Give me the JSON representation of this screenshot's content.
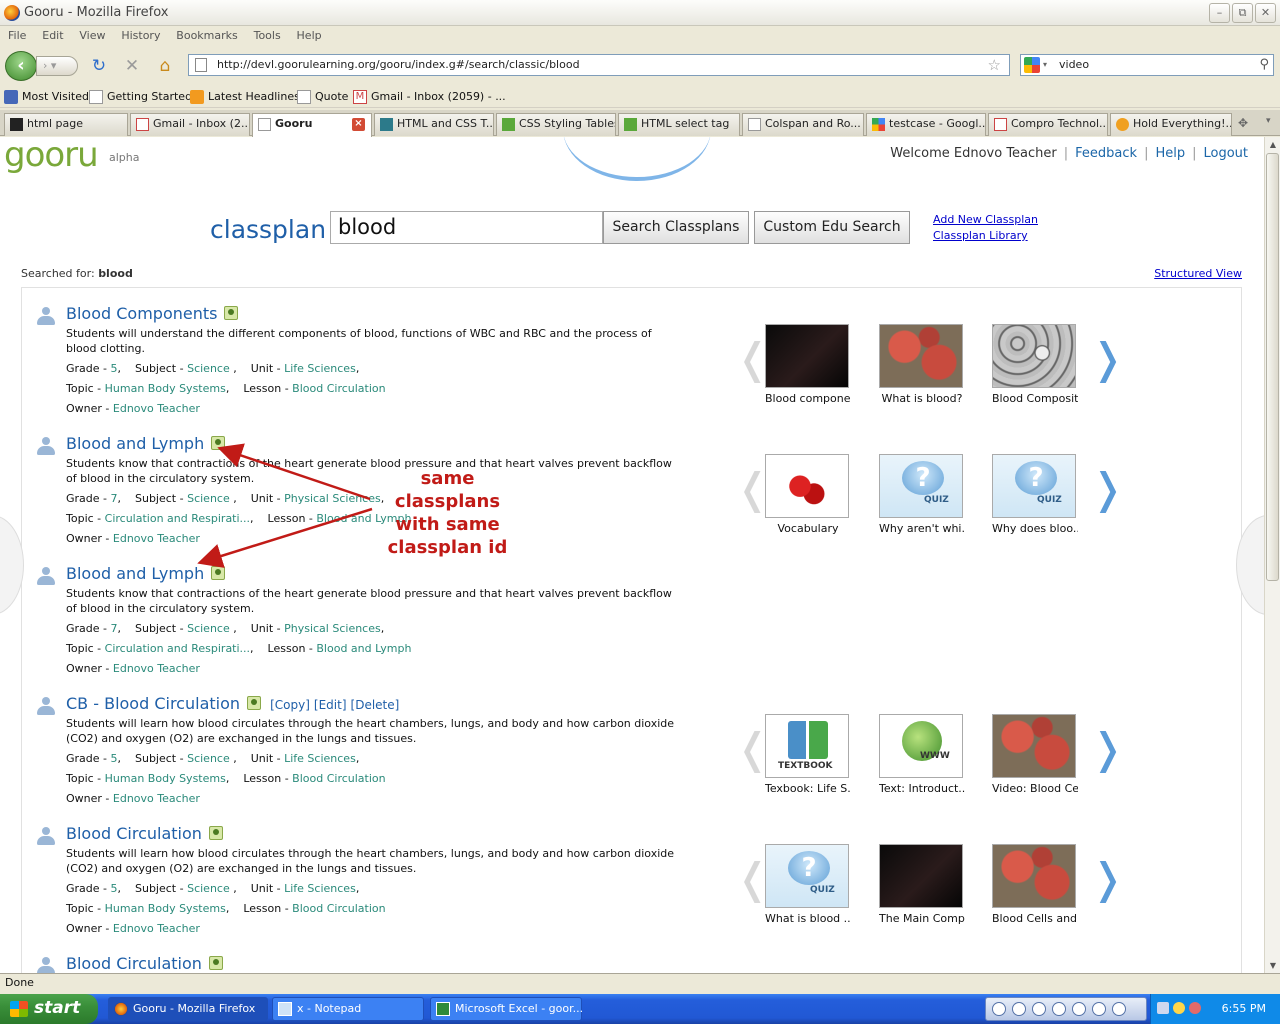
{
  "window": {
    "title": "Gooru - Mozilla Firefox"
  },
  "menu": [
    "File",
    "Edit",
    "View",
    "History",
    "Bookmarks",
    "Tools",
    "Help"
  ],
  "url": "http://devl.goorulearning.org/gooru/index.g#/search/classic/blood",
  "search_engine_value": "video",
  "bookmarks": [
    "Most Visited",
    "Getting Started",
    "Latest Headlines",
    "Quote",
    "Gmail - Inbox (2059) - ..."
  ],
  "tabs": [
    {
      "label": "html page",
      "active": false
    },
    {
      "label": "Gmail - Inbox (2...",
      "active": false
    },
    {
      "label": "Gooru",
      "active": true
    },
    {
      "label": "HTML and CSS T...",
      "active": false
    },
    {
      "label": "CSS Styling Tables",
      "active": false
    },
    {
      "label": "HTML select tag",
      "active": false
    },
    {
      "label": "Colspan and Ro...",
      "active": false
    },
    {
      "label": "testcase - Googl...",
      "active": false
    },
    {
      "label": "Compro Technol...",
      "active": false
    },
    {
      "label": "Hold Everything!...",
      "active": false
    }
  ],
  "site": {
    "logo": "gooru",
    "logo_sub": "alpha",
    "welcome": "Welcome Ednovo Teacher",
    "links": {
      "feedback": "Feedback",
      "help": "Help",
      "logout": "Logout"
    }
  },
  "search": {
    "label": "classplan",
    "value": "blood",
    "btn_search": "Search Classplans",
    "btn_custom": "Custom Edu Search",
    "add_new": "Add New Classplan",
    "library": "Classplan Library",
    "searched_for_label": "Searched for:",
    "searched_for_value": "blood",
    "structured_view": "Structured View"
  },
  "field_labels": {
    "grade": "Grade - ",
    "subject": "Subject - ",
    "unit": "Unit - ",
    "topic": "Topic - ",
    "lesson": "Lesson - ",
    "owner": "Owner - "
  },
  "results": [
    {
      "title": "Blood Components",
      "desc": "Students will understand the different components of blood, functions of WBC and RBC and the process of blood clotting.",
      "grade": "5",
      "subject": "Science",
      "unit": "Life Sciences",
      "topic": "Human Body Systems",
      "lesson": "Blood Circulation",
      "owner": "Ednovo Teacher",
      "thumbs": [
        {
          "caption": "Blood compone...",
          "kind": "dark"
        },
        {
          "caption": "What is blood?",
          "kind": "red"
        },
        {
          "caption": "Blood Compositi...",
          "kind": "grey"
        }
      ]
    },
    {
      "title": "Blood and Lymph",
      "desc": "Students know that contractions of the heart generate blood pressure and that heart valves prevent backflow of blood in the circulatory system.",
      "grade": "7",
      "subject": "Science",
      "unit": "Physical Sciences",
      "topic": "Circulation and Respirati...",
      "lesson": "Blood and Lymph",
      "owner": "Ednovo Teacher",
      "thumbs": [
        {
          "caption": "Vocabulary",
          "kind": "vocab"
        },
        {
          "caption": "Why aren't whi...",
          "kind": "quiz"
        },
        {
          "caption": "Why does bloo...",
          "kind": "quiz"
        }
      ]
    },
    {
      "title": "Blood and Lymph",
      "desc": "Students know that contractions of the heart generate blood pressure and that heart valves prevent backflow of blood in the circulatory system.",
      "grade": "7",
      "subject": "Science",
      "unit": "Physical Sciences",
      "topic": "Circulation and Respirati...",
      "lesson": "Blood and Lymph",
      "owner": "Ednovo Teacher",
      "thumbs": []
    },
    {
      "title": "CB - Blood Circulation",
      "actions": [
        "[Copy]",
        "[Edit]",
        "[Delete]"
      ],
      "desc": "Students will learn how blood circulates through the heart chambers, lungs, and body and how carbon dioxide (CO2) and oxygen (O2) are exchanged in the lungs and tissues.",
      "grade": "5",
      "subject": "Science",
      "unit": "Life Sciences",
      "topic": "Human Body Systems",
      "lesson": "Blood Circulation",
      "owner": "Ednovo Teacher",
      "thumbs": [
        {
          "caption": "Texbook: Life S...",
          "kind": "textbook"
        },
        {
          "caption": "Text: Introduct...",
          "kind": "www"
        },
        {
          "caption": "Video: Blood Ce...",
          "kind": "red"
        }
      ]
    },
    {
      "title": "Blood Circulation",
      "desc": "Students will learn how blood circulates through the heart chambers, lungs, and body and how carbon dioxide (CO2) and oxygen (O2) are exchanged in the lungs and tissues.",
      "grade": "5",
      "subject": "Science",
      "unit": "Life Sciences",
      "topic": "Human Body Systems",
      "lesson": "Blood Circulation",
      "owner": "Ednovo Teacher",
      "thumbs": [
        {
          "caption": "What is blood ...",
          "kind": "quiz"
        },
        {
          "caption": "The Main Comp...",
          "kind": "dark"
        },
        {
          "caption": "Blood Cells and ...",
          "kind": "red"
        }
      ]
    },
    {
      "title": "Blood Circulation",
      "thumbs": []
    }
  ],
  "annotation": {
    "lines": [
      "same",
      "classplans",
      "with same",
      "classplan id"
    ],
    "color": "#c11b17"
  },
  "status": "Done",
  "taskbar": {
    "start": "start",
    "items": [
      "Gooru - Mozilla Firefox",
      "x - Notepad",
      "Microsoft Excel - goor..."
    ],
    "clock": "6:55 PM"
  }
}
